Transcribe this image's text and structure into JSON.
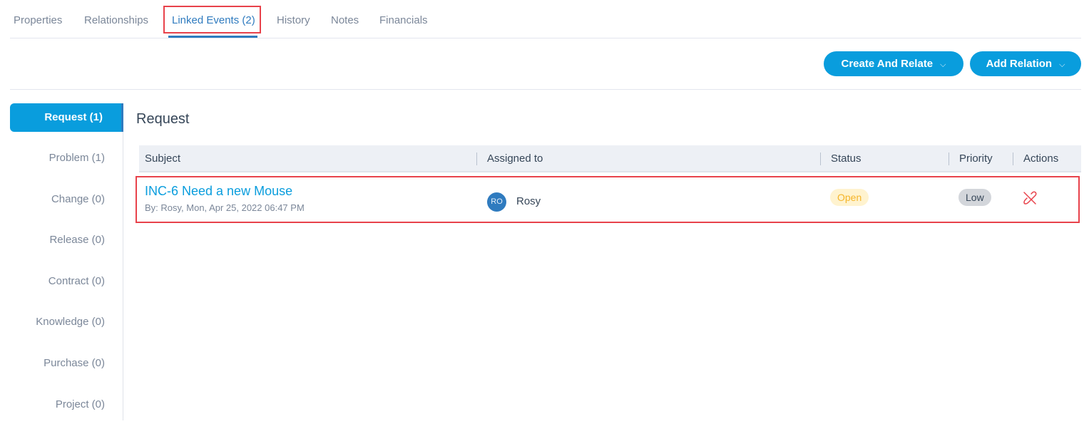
{
  "tabs": [
    {
      "label": "Properties",
      "active": false
    },
    {
      "label": "Relationships",
      "active": false
    },
    {
      "label": "Linked Events (2)",
      "active": true
    },
    {
      "label": "History",
      "active": false
    },
    {
      "label": "Notes",
      "active": false
    },
    {
      "label": "Financials",
      "active": false
    }
  ],
  "toolbar": {
    "create_and_relate_label": "Create And Relate",
    "add_relation_label": "Add Relation",
    "chevron": "⌵"
  },
  "sidebar": {
    "items": [
      {
        "label": "Request (1)",
        "active": true
      },
      {
        "label": "Problem (1)",
        "active": false
      },
      {
        "label": "Change (0)",
        "active": false
      },
      {
        "label": "Release (0)",
        "active": false
      },
      {
        "label": "Contract (0)",
        "active": false
      },
      {
        "label": "Knowledge (0)",
        "active": false
      },
      {
        "label": "Purchase (0)",
        "active": false
      },
      {
        "label": "Project (0)",
        "active": false
      }
    ]
  },
  "main": {
    "section_title": "Request",
    "table": {
      "columns": [
        "Subject",
        "Assigned to",
        "Status",
        "Priority",
        "Actions"
      ],
      "rows": [
        {
          "subject": "INC-6 Need a new Mouse",
          "meta": "By: Rosy, Mon, Apr 25, 2022 06:47 PM",
          "assignee_initials": "RO",
          "assignee": "Rosy",
          "status": "Open",
          "priority": "Low",
          "action_icon": "unlink-icon"
        }
      ]
    }
  },
  "colors": {
    "accent": "#099ddd",
    "active_tab": "#2f7bbf",
    "highlight": "#e8424b",
    "status_open_bg": "#fff3cf",
    "status_open_text": "#f5b52a",
    "priority_low_bg": "#d3d6db",
    "unlink": "#e8424b"
  }
}
